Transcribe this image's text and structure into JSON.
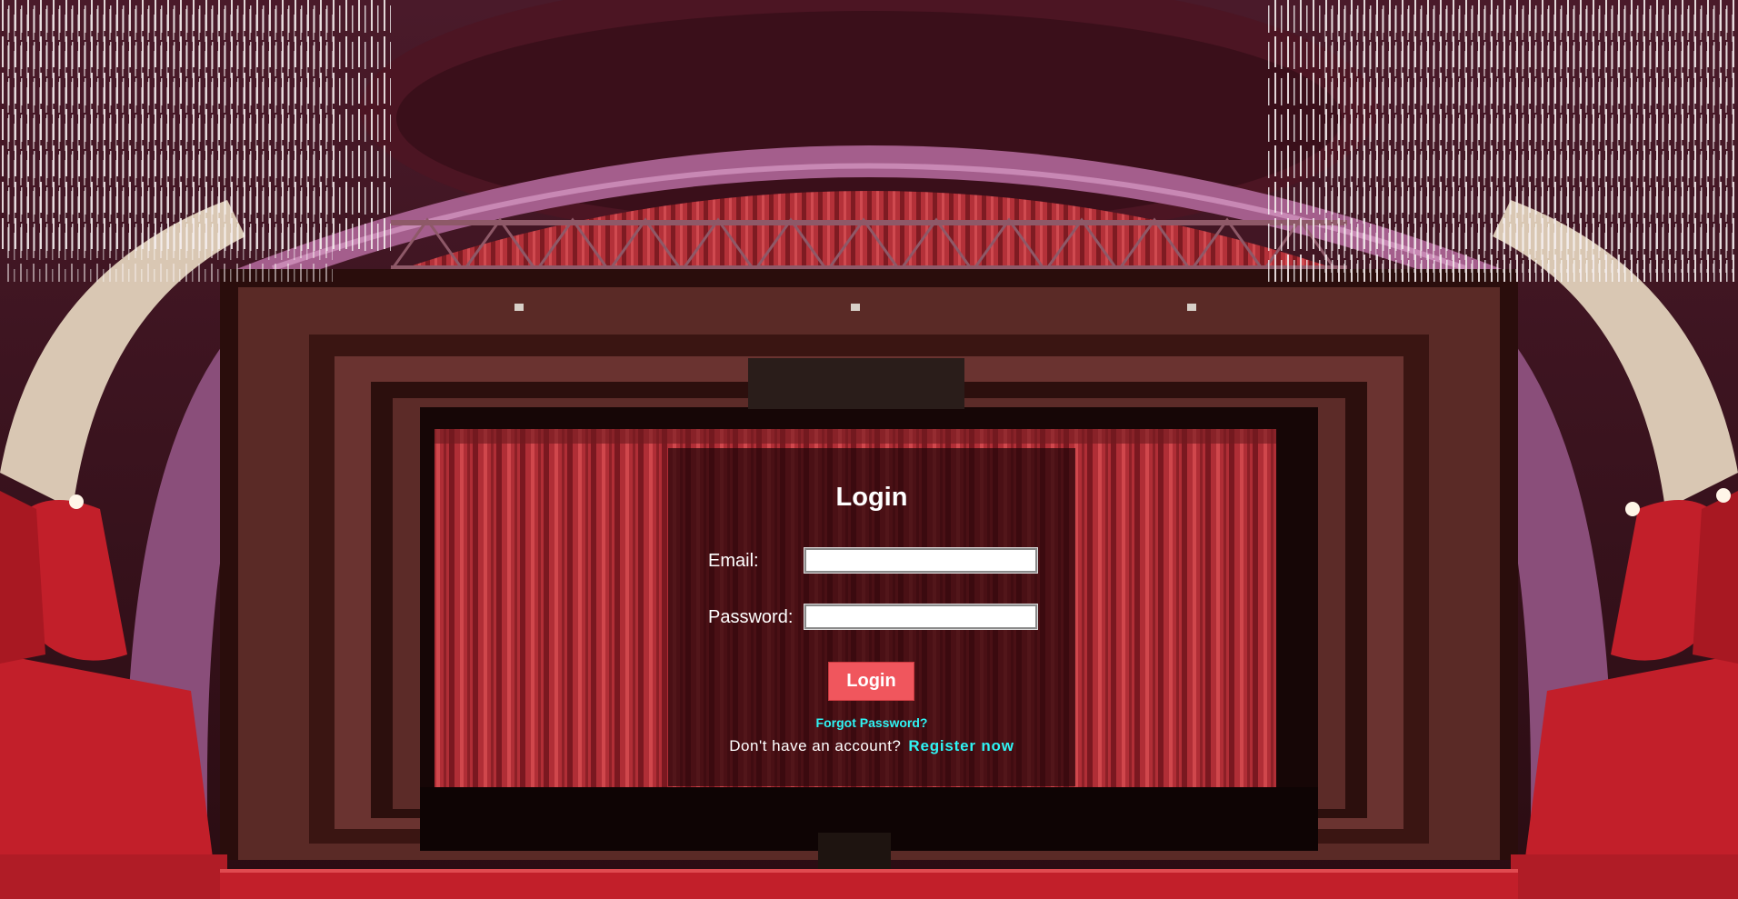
{
  "background": {
    "scene": "theater-stage-background",
    "colors": {
      "curtain": "#b8323a",
      "frame": "#5a2a26",
      "arch": "#a45e8c",
      "seats": "#c21f2a"
    }
  },
  "login": {
    "title": "Login",
    "email_label": "Email:",
    "email_value": "",
    "password_label": "Password:",
    "password_value": "",
    "submit_label": "Login",
    "forgot_password": "Forgot Password?",
    "no_account_text": "Don't have an account?",
    "register_link": "Register now"
  },
  "colors": {
    "panel_bg": "rgba(38,6,10,0.74)",
    "button_bg": "#f0565d",
    "link": "#2ff4f4",
    "text": "#ffffff"
  }
}
